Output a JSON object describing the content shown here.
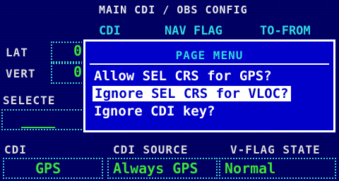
{
  "header": {
    "title": "MAIN CDI / OBS CONFIG"
  },
  "columns": {
    "cdi": "CDI",
    "nav_flag": "NAV FLAG",
    "to_from": "TO-FROM"
  },
  "rows": {
    "lat": "LAT",
    "vert": "VERT",
    "lat_value": "0",
    "vert_value": "0",
    "selected_label": "SELECTE",
    "selected_value": "____"
  },
  "bottom": {
    "cdi_label": "CDI",
    "source_label": "CDI SOURCE",
    "vflag_label": "V-FLAG STATE",
    "cdi_value": "GPS",
    "source_value": "Always GPS",
    "vflag_value": "Normal"
  },
  "menu": {
    "title": "PAGE MENU",
    "items": [
      {
        "label": "Allow SEL CRS for GPS?"
      },
      {
        "label": "Ignore SEL CRS for VLOC?"
      },
      {
        "label": "Ignore CDI key?"
      }
    ],
    "selected_index": 1
  },
  "colors": {
    "background": "#00006b",
    "menu_bg": "#0000c8",
    "green": "#3ce03c",
    "cyan": "#2fd9e0"
  }
}
